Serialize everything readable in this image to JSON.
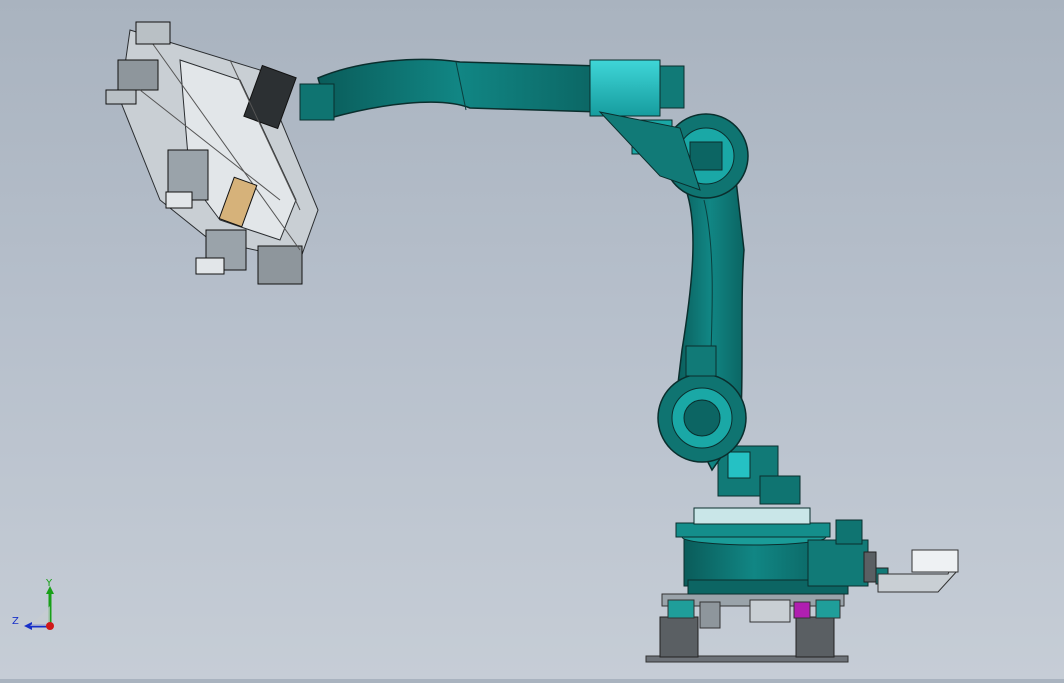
{
  "triad": {
    "y_label": "Y",
    "z_label": "Z",
    "x_color": "#d01818",
    "y_color": "#18a018",
    "z_color": "#1830c8"
  },
  "model": {
    "primary_color": "#0f7f7a",
    "accent_color": "#25c1c4",
    "tool_color": "#c9cfd4",
    "highlight_color": "#b01fb0"
  }
}
